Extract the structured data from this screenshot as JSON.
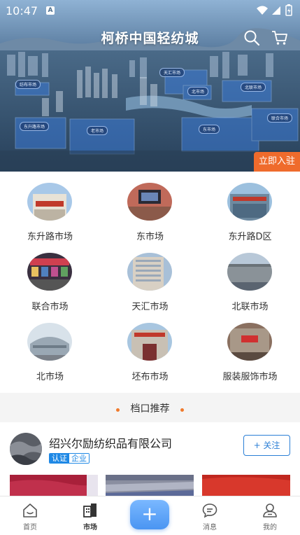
{
  "status_bar": {
    "time": "10:47",
    "notification": "A"
  },
  "header": {
    "title": "柯桥中国轻纺城"
  },
  "hero": {
    "map_labels": [
      "纺布市场",
      "天汇市场",
      "北市场",
      "北联市场",
      "东升路市场",
      "老市场",
      "东市场",
      "联合市场"
    ],
    "settle_button": "立即入驻"
  },
  "markets": [
    {
      "name": "东升路市场"
    },
    {
      "name": "东市场"
    },
    {
      "name": "东升路D区"
    },
    {
      "name": "联合市场"
    },
    {
      "name": "天汇市场"
    },
    {
      "name": "北联市场"
    },
    {
      "name": "北市场"
    },
    {
      "name": "坯布市场"
    },
    {
      "name": "服装服饰市场"
    }
  ],
  "section": {
    "title": "档口推荐"
  },
  "shop": {
    "name": "绍兴尔励纺织品有限公司",
    "badge_cert": "认证",
    "badge_type": "企业",
    "follow_label": "+ 关注"
  },
  "bottom_nav": {
    "items": [
      {
        "label": "首页",
        "icon": "home-icon"
      },
      {
        "label": "市场",
        "icon": "market-icon"
      },
      {
        "label": "+",
        "icon": "plus-icon"
      },
      {
        "label": "消息",
        "icon": "message-icon"
      },
      {
        "label": "我的",
        "icon": "profile-icon"
      }
    ],
    "active": "市场"
  },
  "colors": {
    "accent": "#ef6b2c",
    "primary_blue": "#2b7fd6",
    "dot": "#f07a2d"
  }
}
